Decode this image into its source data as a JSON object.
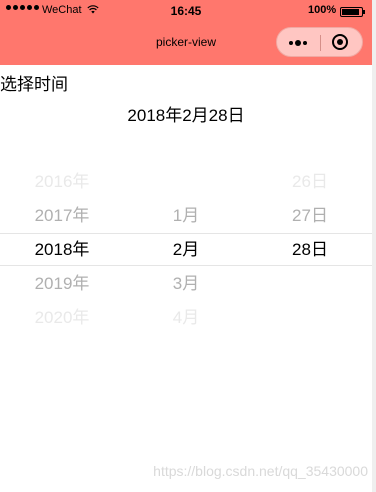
{
  "status_bar": {
    "carrier": "WeChat",
    "time": "16:45",
    "battery": "100%"
  },
  "nav": {
    "title": "picker-view",
    "more_icon": "more-dots-icon",
    "close_icon": "target-circle-icon",
    "background": "#ff776d"
  },
  "section_label": "选择时间",
  "selected_date": "2018年2月28日",
  "picker": {
    "years": [
      "2016年",
      "2017年",
      "2018年",
      "2019年",
      "2020年"
    ],
    "months": [
      "",
      "1月",
      "2月",
      "3月",
      "4月"
    ],
    "days": [
      "26日",
      "27日",
      "28日",
      "",
      ""
    ]
  },
  "watermark": "https://blog.csdn.net/qq_35430000"
}
